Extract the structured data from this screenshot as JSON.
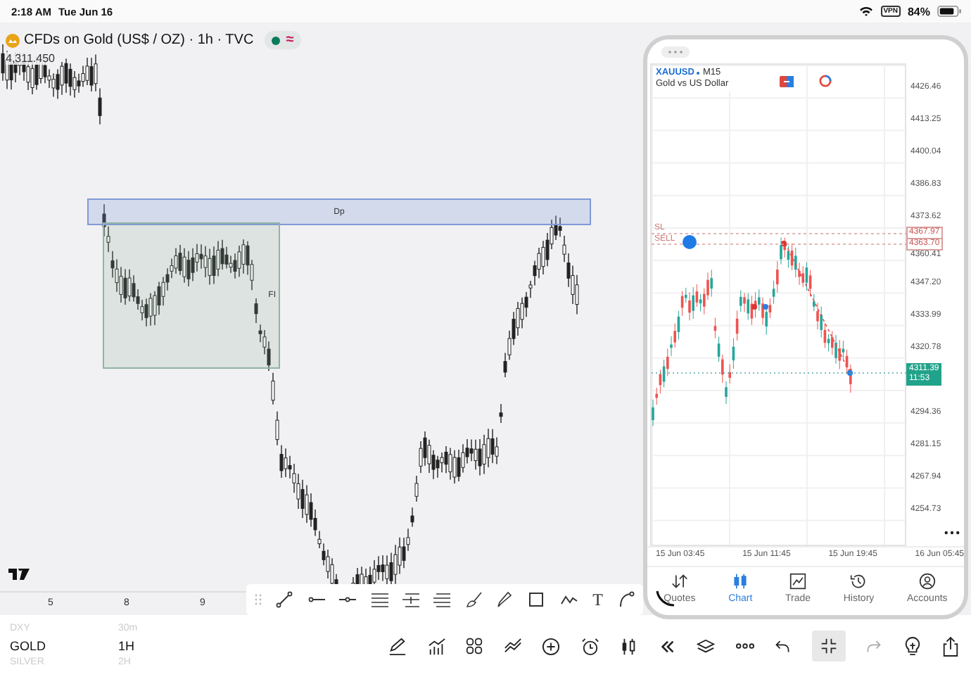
{
  "status_bar": {
    "time": "2:18 AM",
    "date": "Tue Jun 16",
    "vpn": "VPN",
    "battery": "84%"
  },
  "main_chart": {
    "title": "CFDs on Gold (US$ / OZ) · 1h · TVC",
    "status_glyph": "≈",
    "price": "4,311.450",
    "zones": [
      {
        "kind": "band",
        "label": "Dp"
      },
      {
        "kind": "box",
        "label": "FI"
      }
    ],
    "x_labels": [
      "5",
      "8",
      "9"
    ]
  },
  "drawing_tools": {
    "text_tool": "T"
  },
  "watchlist": [
    {
      "symbol": "DXY",
      "interval": "30m",
      "selected": false
    },
    {
      "symbol": "GOLD",
      "interval": "1H",
      "selected": true
    },
    {
      "symbol": "SILVER",
      "interval": "2H",
      "selected": false
    }
  ],
  "float_window": {
    "symbol": "XAUUSD",
    "timeframe": "M15",
    "description": "Gold vs US Dollar",
    "y_labels": [
      "4426.46",
      "4413.25",
      "4400.04",
      "4386.83",
      "4373.62",
      "4360.41",
      "4347.20",
      "4333.99",
      "4320.78",
      "4294.36",
      "4281.15",
      "4267.94",
      "4254.73"
    ],
    "x_labels": [
      "15 Jun 03:45",
      "15 Jun 11:45",
      "15 Jun 19:45",
      "16 Jun 05:45"
    ],
    "order_labels": [
      {
        "kind": "sl",
        "text": "SL"
      },
      {
        "kind": "sell",
        "text": "SELL"
      }
    ],
    "price_tags": [
      {
        "kind": "sl",
        "text": "4367.97"
      },
      {
        "kind": "sell",
        "text": "4363.70"
      },
      {
        "kind": "bid",
        "text": "4311.39",
        "sub": "11:53"
      }
    ],
    "tabs": [
      {
        "kind": "quotes",
        "label": "Quotes",
        "selected": false
      },
      {
        "kind": "chart",
        "label": "Chart",
        "selected": true
      },
      {
        "kind": "trade",
        "label": "Trade",
        "selected": false
      },
      {
        "kind": "history",
        "label": "History",
        "selected": false
      },
      {
        "kind": "accounts",
        "label": "Accounts",
        "selected": false
      }
    ]
  }
}
